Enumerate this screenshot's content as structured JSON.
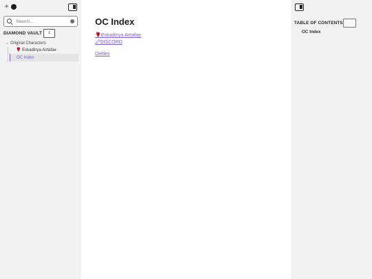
{
  "left_sidebar": {
    "search": {
      "placeholder": "Search..."
    },
    "vault_title": "DIAMOND VAULT",
    "tree": {
      "folder": "Original Characters",
      "items": [
        {
          "label": "🌹 Eskadinya Airtafae",
          "active": false
        },
        {
          "label": "OC Index",
          "active": true
        }
      ]
    }
  },
  "main": {
    "title": "OC Index",
    "links": [
      {
        "label": "🌹Eskadinya Airtafae"
      },
      {
        "label": "🖉DISCORD"
      },
      {
        "label": "Deities"
      }
    ]
  },
  "right_sidebar": {
    "toc_title": "TABLE OF CONTENTS",
    "toc_items": [
      "OC Index"
    ]
  },
  "colors": {
    "accent": "#7b5ad6",
    "sidebar_bg": "#f2f2f2"
  }
}
